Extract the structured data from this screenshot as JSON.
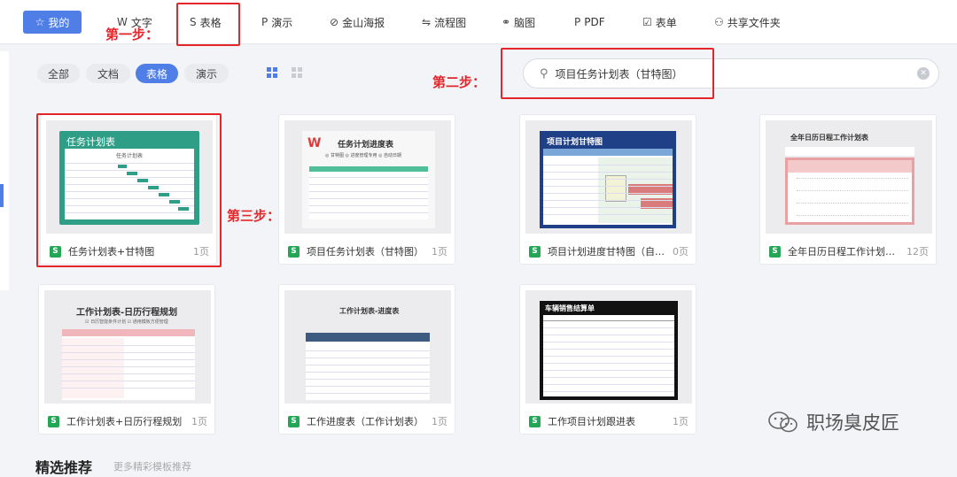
{
  "topbar": {
    "mine_label": "我的",
    "nav": [
      {
        "icon": "text-w-icon",
        "glyph": "W",
        "label": "文字"
      },
      {
        "icon": "spreadsheet-s-icon",
        "glyph": "S",
        "label": "表格"
      },
      {
        "icon": "presentation-p-icon",
        "glyph": "P",
        "label": "演示"
      },
      {
        "icon": "kingsoft-poster-icon",
        "glyph": "⊘",
        "label": "金山海报"
      },
      {
        "icon": "flowchart-icon",
        "glyph": "⇋",
        "label": "流程图"
      },
      {
        "icon": "mindmap-icon",
        "glyph": "⚭",
        "label": "脑图"
      },
      {
        "icon": "pdf-icon",
        "glyph": "P",
        "label": "PDF"
      },
      {
        "icon": "form-icon",
        "glyph": "☑",
        "label": "表单"
      },
      {
        "icon": "shared-folder-icon",
        "glyph": "⚇",
        "label": "共享文件夹"
      }
    ]
  },
  "steps": {
    "step1": "第一步：",
    "step2": "第二步：",
    "step3": "第三步："
  },
  "filters": [
    "全部",
    "文档",
    "表格",
    "演示"
  ],
  "active_filter": "表格",
  "search": {
    "value": "项目任务计划表（甘特图）"
  },
  "cards": [
    {
      "name": "任务计划表+甘特图",
      "pages": "1页",
      "thumb_title": "任务计划表",
      "thumb_sub": "任务计划表"
    },
    {
      "name": "项目任务计划表（甘特图）",
      "pages": "1页",
      "thumb_title": "任务计划进度表",
      "thumb_sub": "◎ 甘特图   ◎ 进度管理专用   ◎ 自动日期"
    },
    {
      "name": "项目计划进度甘特图（自动…",
      "pages": "0页",
      "thumb_title": "项目计划甘特图",
      "thumb_sub": ""
    },
    {
      "name": "全年日历日程工作计划表（…",
      "pages": "12页",
      "thumb_title": "全年日历日程工作计划表",
      "thumb_sub": ""
    },
    {
      "name": "工作计划表+日历行程规划",
      "pages": "1页",
      "thumb_title": "工作计划表-日历行程规划",
      "thumb_sub": "☑ 日历智能条件计划   ☑ 通用模板方便管理"
    },
    {
      "name": "工作进度表（工作计划表）",
      "pages": "1页",
      "thumb_title": "工作计划表-进度表",
      "thumb_sub": ""
    },
    {
      "name": "工作项目计划跟进表",
      "pages": "1页",
      "thumb_title": "车辆销售结算单",
      "thumb_sub": ""
    }
  ],
  "section": {
    "title": "精选推荐",
    "subtitle": "更多精彩模板推荐"
  },
  "watermark": "职场臭皮匠",
  "colors": {
    "accent": "#4f7ee6",
    "highlight": "#e4262b",
    "sheet_green": "#24a657"
  }
}
